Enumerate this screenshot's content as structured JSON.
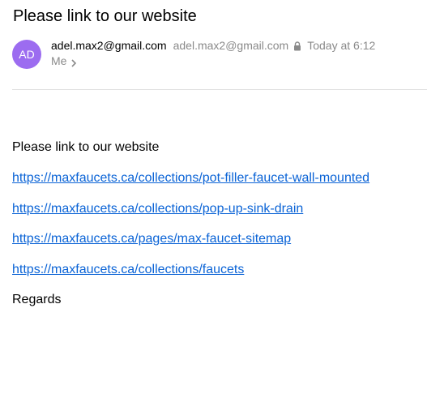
{
  "email": {
    "subject": "Please link to our website",
    "avatar_initials": "AD",
    "avatar_color": "#9c6cf0",
    "sender_name": "adel.max2@gmail.com",
    "sender_email": "adel.max2@gmail.com",
    "date": "Today at 6:12",
    "recipient": "Me",
    "body": {
      "intro": "Please link to our website",
      "links": [
        "https://maxfaucets.ca/collections/pot-filler-faucet-wall-mounted",
        "https://maxfaucets.ca/collections/pop-up-sink-drain",
        "https://maxfaucets.ca/pages/max-faucet-sitemap",
        "https://maxfaucets.ca/collections/faucets"
      ],
      "closing": "Regards"
    }
  },
  "icons": {
    "lock": "lock-icon",
    "chevron": "chevron-right-icon"
  },
  "colors": {
    "link": "#0a63d6",
    "muted_text": "#8a8a8a",
    "divider": "#e0e0e0"
  }
}
